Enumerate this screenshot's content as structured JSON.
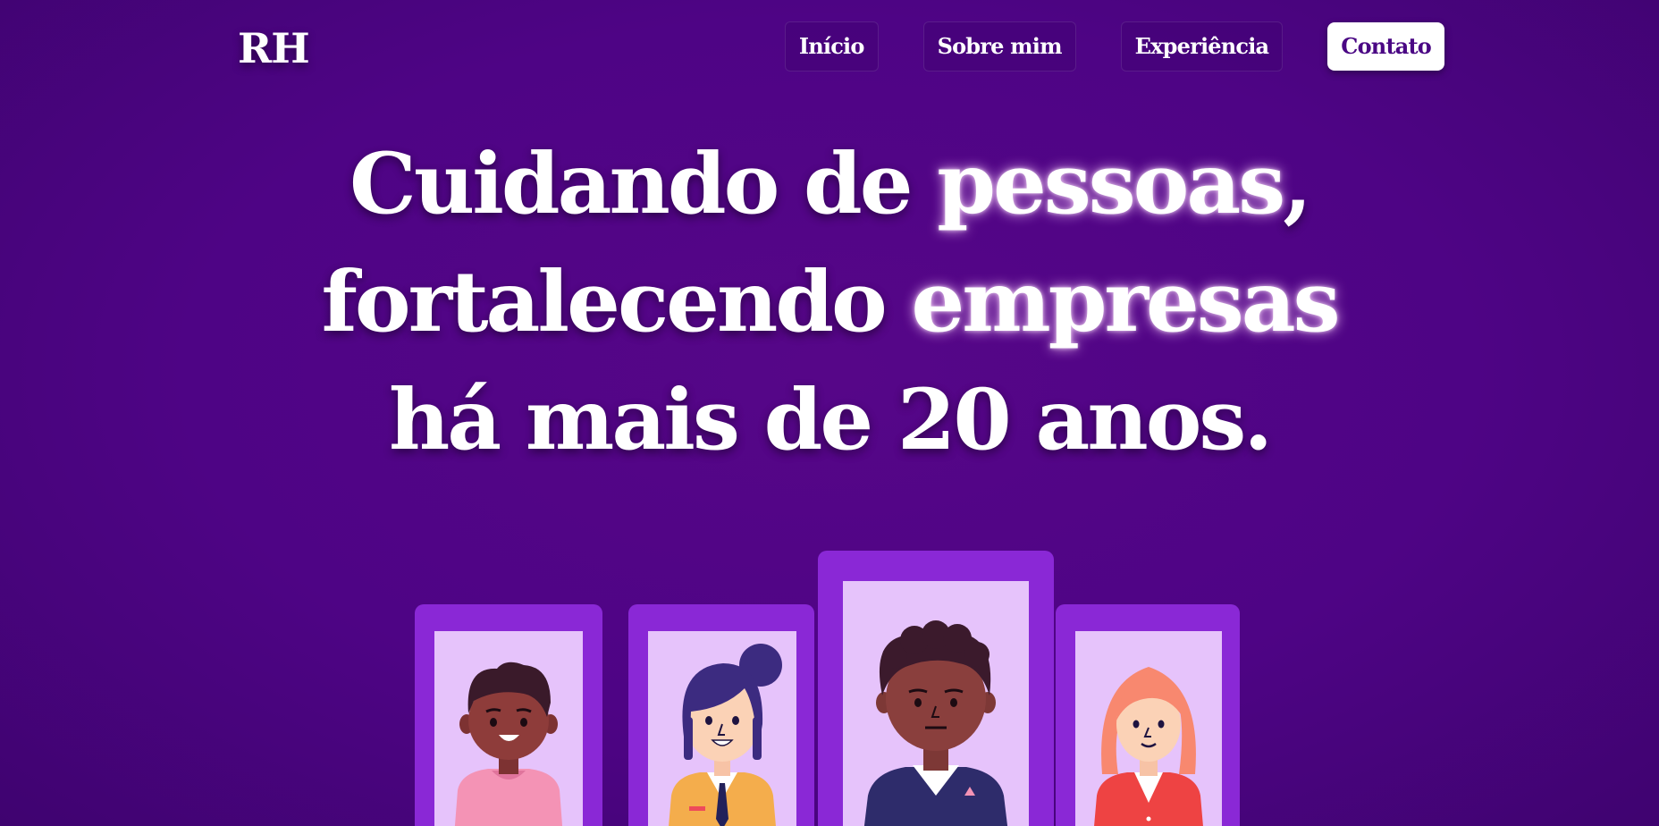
{
  "header": {
    "logo": "RH",
    "nav": [
      {
        "label": "Início"
      },
      {
        "label": "Sobre mim"
      },
      {
        "label": "Experiência"
      },
      {
        "label": "Contato"
      }
    ]
  },
  "hero": {
    "line1_a": "Cuidando de ",
    "line1_hl": "pessoas",
    "line1_b": ",",
    "line2_a": "fortalecendo ",
    "line2_hl": "empresas",
    "line3": "há mais de 20 anos."
  },
  "colors": {
    "background": "#4e0485",
    "card_frame": "#8a28d6",
    "card_inner": "#e6c3fb",
    "cta_text": "#4a0784"
  },
  "illustrations": [
    {
      "name": "person-man-pink-shirt",
      "skin": "#8e3c3a"
    },
    {
      "name": "person-woman-bun",
      "skin": "#fbd2b6"
    },
    {
      "name": "person-man-suit",
      "skin": "#8a3f3d"
    },
    {
      "name": "person-woman-red-hair",
      "skin": "#fbd2b6"
    }
  ]
}
